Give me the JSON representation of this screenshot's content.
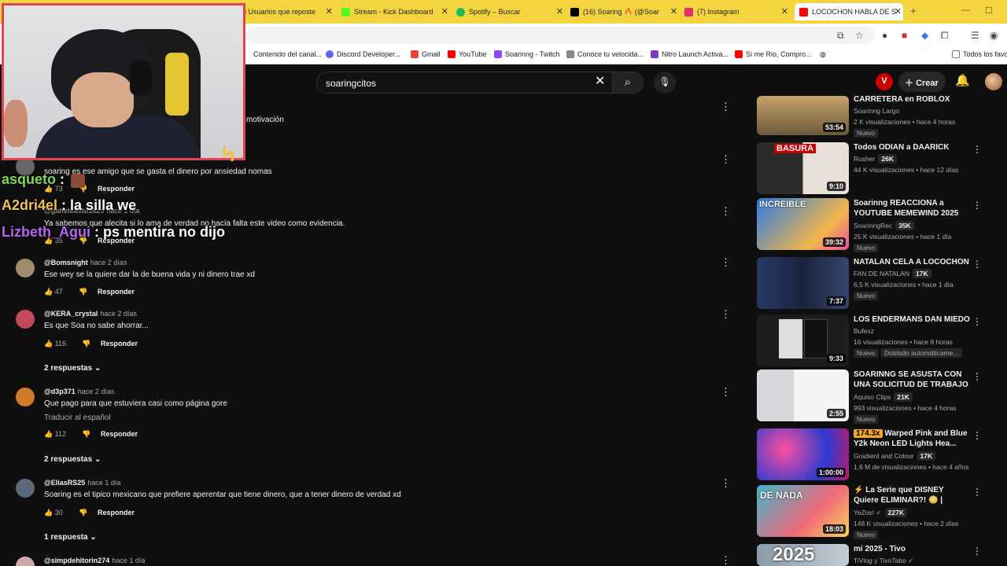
{
  "browser": {
    "tabs": [
      {
        "label": "3) Usuarios que reposte",
        "color": "#888"
      },
      {
        "label": "Stream - Kick Dashboard",
        "color": "#53fc18"
      },
      {
        "label": "Spotify – Buscar",
        "color": "#1db954"
      },
      {
        "label": "(16) Soaring 🔥 (@Soar",
        "color": "#000000"
      },
      {
        "label": "(7) Instagram",
        "color": "#e1306c"
      },
      {
        "label": "LOCOCHON HABLA DE S",
        "color": "#ff0000"
      }
    ],
    "new_tab": "+",
    "bookmarks": [
      "Contenido del canal...",
      "Discord Developer...",
      "Gmail",
      "YouTube",
      "Soarinng - Twitch",
      "Conoce tu velocida...",
      "Nitro Launch Activa...",
      "Si me Rio, Compro...",
      "Todos los favo"
    ]
  },
  "youtube": {
    "search_value": "soaringcitos",
    "crear_label": "Crear"
  },
  "chat": [
    {
      "user": "asqueto",
      "msg": " :",
      "color": "#7ed957"
    },
    {
      "user": "A2dri4el",
      "msg": " : la silla we",
      "color": "#f2c14e"
    },
    {
      "user": "Lizbeth_Agui",
      "msg": " : ps mentira no dijo",
      "color": "#b565f0"
    }
  ],
  "comments_partial": {
    "top_text": "motivación",
    "c1_text": "soaring es ese amigo que se gasta el dinero por ansiedad nomas",
    "c1_likes": "73",
    "c2_user": "@gaheteastu1625",
    "c2_time": "hace 1 día",
    "c2_text": "Ya sabemos que alecita si lo ama de verdad no hacía falta este video como evidencia.",
    "c2_likes": "35"
  },
  "comments": [
    {
      "user": "@Bomsnight",
      "time": "hace 2 días",
      "text": "Ese wey se la quiere dar la de buena vida y ni dinero trae xd",
      "likes": "47",
      "reply": "Responder"
    },
    {
      "user": "@KERA_crystal",
      "time": "hace 2 días",
      "text": "Es que Soa no sabe ahorrar...",
      "likes": "116",
      "reply": "Responder",
      "replies": "2 respuestas"
    },
    {
      "user": "@d3p371",
      "time": "hace 2 días",
      "text": "Que pago para que estuviera casi como página gore",
      "likes": "112",
      "reply": "Responder",
      "translate": "Traducir al español",
      "replies": "2 respuestas"
    },
    {
      "user": "@EliasRS25",
      "time": "hace 1 día",
      "text": "Soaring es el tipico mexicano que prefiere aperentar que tiene dinero, que a tener dinero de verdad xd",
      "likes": "30",
      "reply": "Responder",
      "replies": "1 respuesta"
    },
    {
      "user": "@simpdehitorin274",
      "time": "hace 1 día"
    }
  ],
  "recommendations": [
    {
      "title": "CARRETERA en ROBLOX",
      "channel": "Soarinng Largo",
      "meta": "2 K visualizaciones • hace 4 horas",
      "new": "Nuevo",
      "duration": "53:54",
      "thumb": "#a68c5a"
    },
    {
      "title": "Todos ODIAN a DAARICK",
      "channel": "Rusher",
      "badge": "26K",
      "meta": "44 K visualizaciones • hace 12 días",
      "duration": "9:10",
      "thumb": "#bdbdbd",
      "overlay": "BASURA"
    },
    {
      "title": "Soarinng REACCIONA a YOUTUBE MEMEWIND 2025 d...",
      "channel": "SoarinngRec",
      "badge": "35K",
      "meta": "25 K visualizaciones • hace 1 día",
      "new": "Nuevo",
      "duration": "39:32",
      "thumb": "#3b6fc9",
      "overlay": "INCREIBLE"
    },
    {
      "title": "NATALAN CELA A LOCOCHON",
      "channel": "FAN DE NATALAN",
      "badge": "17K",
      "meta": "6,5 K visualizaciones • hace 1 día",
      "new": "Nuevo",
      "duration": "7:37",
      "thumb": "#1b2a4a"
    },
    {
      "title": "LOS ENDERMANS DAN MIEDO",
      "channel": "Bufexz",
      "meta": "16 visualizaciones • hace 8 horas",
      "new": "Nuevo",
      "dub": "Doblado automáticame...",
      "duration": "9:33",
      "thumb": "#2a2a2a"
    },
    {
      "title": "SOARINNG SE ASUSTA CON UNA SOLICITUD DE TRABAJO ...",
      "channel": "Aquiso Clips",
      "badge": "21K",
      "meta": "993 visualizaciones • hace 4 horas",
      "new": "Nuevo",
      "duration": "2:55",
      "thumb": "#e8e8ee"
    },
    {
      "title": "Warped Pink and Blue Y2k Neon LED Lights Hea...",
      "mult": "174.3x",
      "channel": "Gradient and Colour",
      "badge": "17K",
      "meta": "1,6 M de visualizaciones • hace 4 años",
      "duration": "1:00:00",
      "thumb": "#c9307c"
    },
    {
      "title": "⚡ La Serie que DISNEY Quiere ELIMINAR?! 😳 | Hailey's On It ...",
      "channel": "YeZos! ✓",
      "badge": "227K",
      "meta": "148 K visualizaciones • hace 2 días",
      "new": "Nuevo",
      "duration": "18:03",
      "thumb": "#e9556b",
      "overlay": "DE NADA"
    },
    {
      "title": "mi 2025 - Tivo",
      "channel": "TiVlog y TivoTabo ✓",
      "duration": "",
      "thumb": "#7b8a9a",
      "overlay": "2025"
    }
  ]
}
